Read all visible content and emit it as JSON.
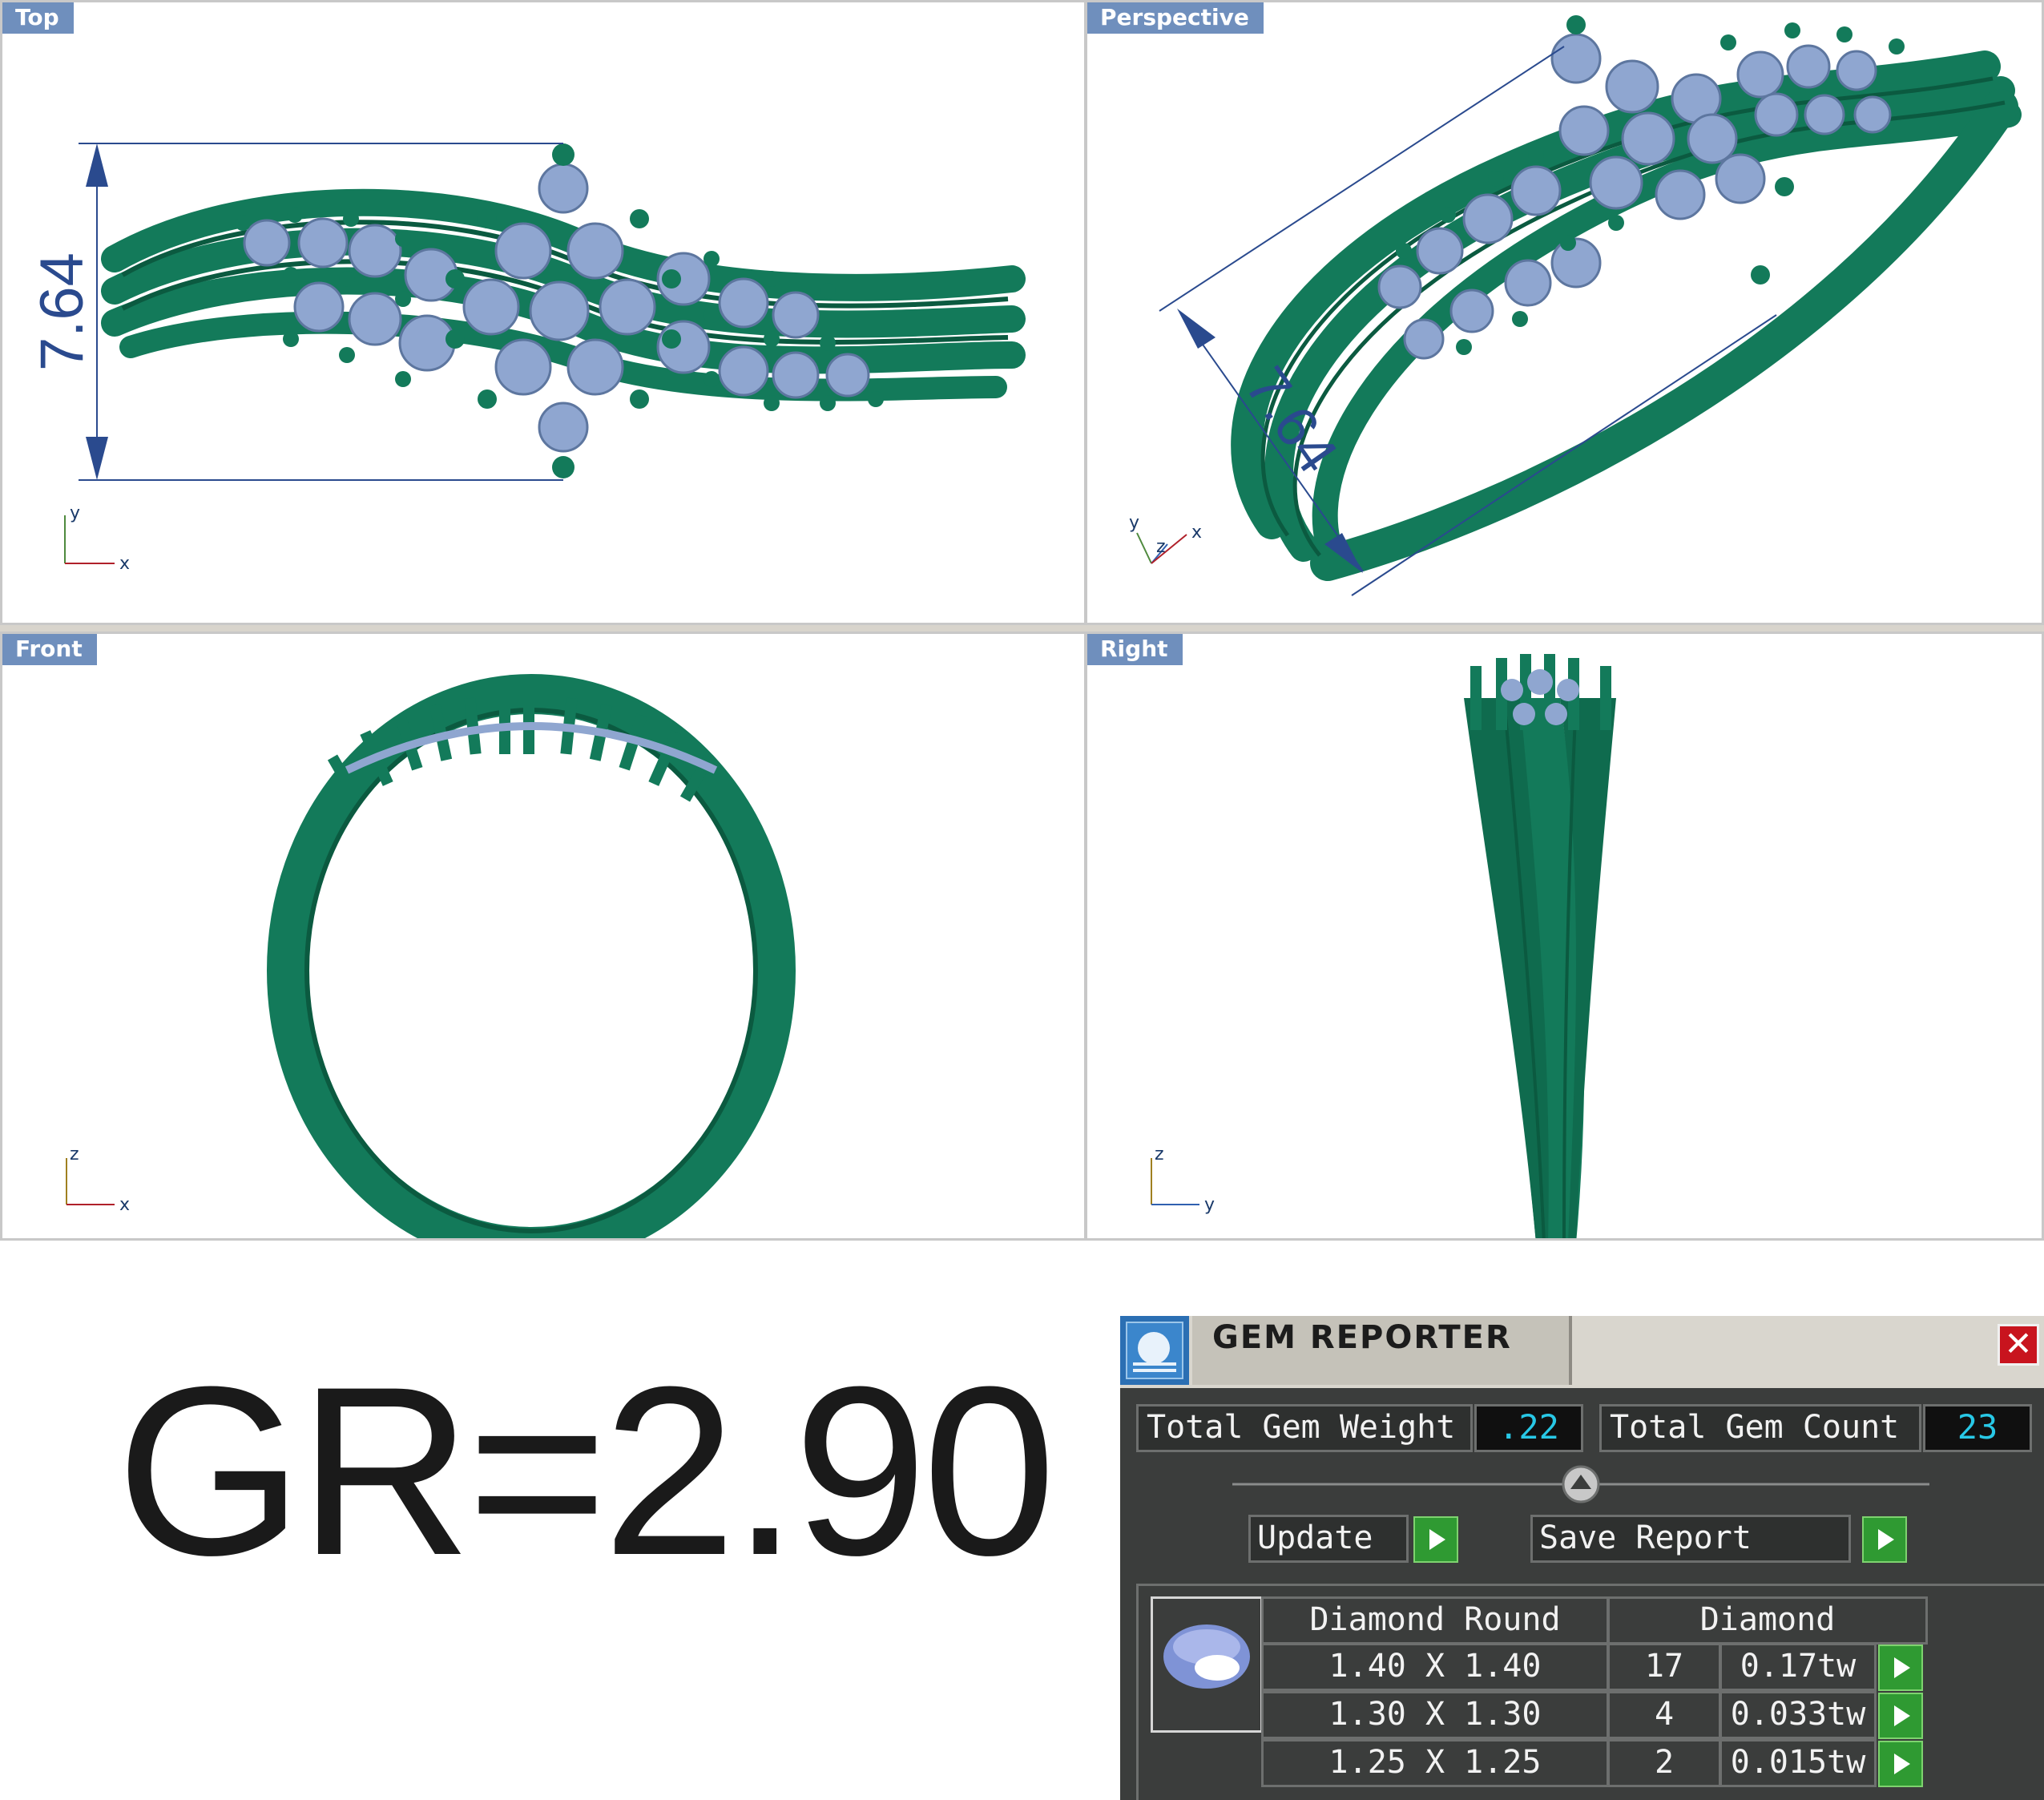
{
  "viewports": {
    "top": {
      "label": "Top",
      "dimension": "7.64",
      "axes": [
        "y",
        "x"
      ]
    },
    "perspective": {
      "label": "Perspective",
      "dimension": "7.64",
      "axes": [
        "y",
        "z",
        "x"
      ]
    },
    "front": {
      "label": "Front",
      "axes": [
        "z",
        "x"
      ]
    },
    "right": {
      "label": "Right",
      "axes": [
        "z",
        "y"
      ]
    }
  },
  "gold_ratio": "GR=2.90",
  "gem_reporter": {
    "title": "GEM REPORTER",
    "close_symbol": "✕",
    "total_weight_label": "Total Gem Weight",
    "total_weight_value": ".22",
    "total_count_label": "Total Gem Count",
    "total_count_value": "23",
    "update_label": "Update",
    "save_report_label": "Save Report",
    "table": {
      "headers": [
        "Diamond Round",
        "Diamond"
      ],
      "rows": [
        {
          "size": "1.40 X 1.40",
          "count": "17",
          "weight": "0.17tw"
        },
        {
          "size": "1.30 X 1.30",
          "count": "4",
          "weight": "0.033tw"
        },
        {
          "size": "1.25 X 1.25",
          "count": "2",
          "weight": "0.015tw"
        }
      ]
    }
  },
  "colors": {
    "metal": "#137a5a",
    "metal_dark": "#0b5a40",
    "gem": "#8fa6d0",
    "dimension": "#2a4a8e",
    "tab": "#6f8fbd"
  }
}
